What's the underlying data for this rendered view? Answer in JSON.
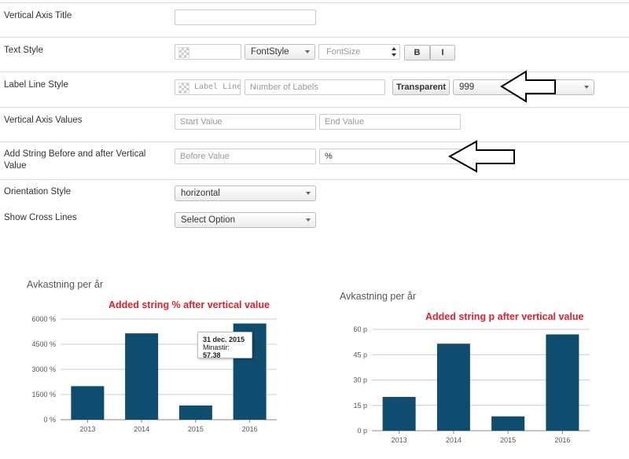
{
  "form": {
    "rows": [
      {
        "label": "Vertical Axis Title"
      },
      {
        "label": "Text Style"
      },
      {
        "label": "Label Line Style"
      },
      {
        "label": "Vertical Axis Values"
      },
      {
        "label": "Add String Before and after Vertical Value"
      },
      {
        "label": "Orientation Style"
      },
      {
        "label": "Show Cross Lines"
      }
    ],
    "text_style": {
      "font_style": "FontStyle",
      "font_size_placeholder": "FontSize",
      "bold": "B",
      "italic": "I"
    },
    "label_line_style": {
      "color_placeholder": "Label Line Color",
      "number_placeholder": "Number of Labels",
      "transparent": "Transparent",
      "value": "999"
    },
    "axis_values": {
      "start_placeholder": "Start Value",
      "end_placeholder": "End Value"
    },
    "add_string": {
      "before_placeholder": "Before Value",
      "after_value": "%"
    },
    "orientation": {
      "value": "horizontal"
    },
    "cross_lines": {
      "value": "Select Option"
    }
  },
  "colors": {
    "bar": "#0e4d6e",
    "note": "#e0202a",
    "grid": "#cccccc"
  },
  "chart_data": [
    {
      "type": "bar",
      "title": "Avkastning per år",
      "annotation": "Added string % after vertical value",
      "categories": [
        "2013",
        "2014",
        "2015",
        "2016"
      ],
      "values": [
        2000,
        5150,
        850,
        5738
      ],
      "ytick_values": [
        0,
        1500,
        3000,
        4500,
        6000
      ],
      "ytick_labels": [
        "0 %",
        "1500 %",
        "3000 %",
        "4500 %",
        "6000 %"
      ],
      "ylim": [
        0,
        6000
      ],
      "tooltip": {
        "date": "31 dec. 2015",
        "label": "Minastir:",
        "value": "57.38"
      }
    },
    {
      "type": "bar",
      "title": "Avkastning per år",
      "annotation": "Added string p after vertical value",
      "categories": [
        "2013",
        "2014",
        "2015",
        "2016"
      ],
      "values": [
        20,
        51.5,
        8.5,
        57
      ],
      "ytick_values": [
        0,
        15,
        30,
        45,
        60
      ],
      "ytick_labels": [
        "0 p",
        "15 p",
        "30 p",
        "45 p",
        "60 p"
      ],
      "ylim": [
        0,
        60
      ]
    }
  ]
}
